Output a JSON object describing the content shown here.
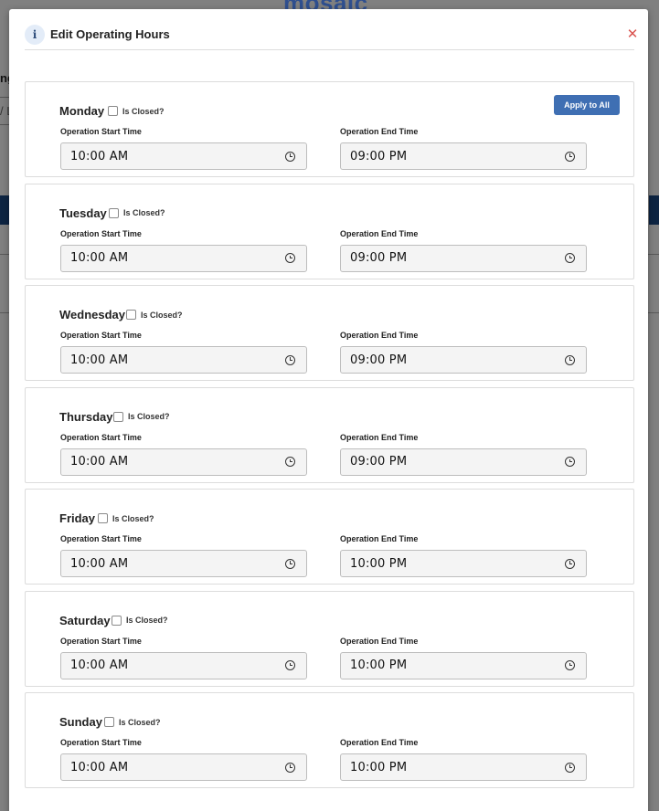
{
  "background": {
    "logo_text": "mosaic",
    "partial_text_1": "ng",
    "partial_text_2": "/ L"
  },
  "modal": {
    "title": "Edit Operating Hours",
    "info_icon": "info-icon",
    "close_icon": "close-icon",
    "apply_to_all_label": "Apply to All",
    "closed_label": "Is Closed?",
    "start_label": "Operation Start Time",
    "end_label": "Operation End Time",
    "days": [
      {
        "name": "Monday",
        "closed": false,
        "start": "10:00 AM",
        "end": "09:00 PM"
      },
      {
        "name": "Tuesday",
        "closed": false,
        "start": "10:00 AM",
        "end": "09:00 PM"
      },
      {
        "name": "Wednesday",
        "closed": false,
        "start": "10:00 AM",
        "end": "09:00 PM"
      },
      {
        "name": "Thursday",
        "closed": false,
        "start": "10:00 AM",
        "end": "09:00 PM"
      },
      {
        "name": "Friday",
        "closed": false,
        "start": "10:00 AM",
        "end": "10:00 PM"
      },
      {
        "name": "Saturday",
        "closed": false,
        "start": "10:00 AM",
        "end": "10:00 PM"
      },
      {
        "name": "Sunday",
        "closed": false,
        "start": "10:00 AM",
        "end": "10:00 PM"
      }
    ]
  },
  "colors": {
    "accent": "#3f6fb3",
    "close": "#d9534f",
    "overlay": "#808080",
    "band": "#0d2442"
  }
}
